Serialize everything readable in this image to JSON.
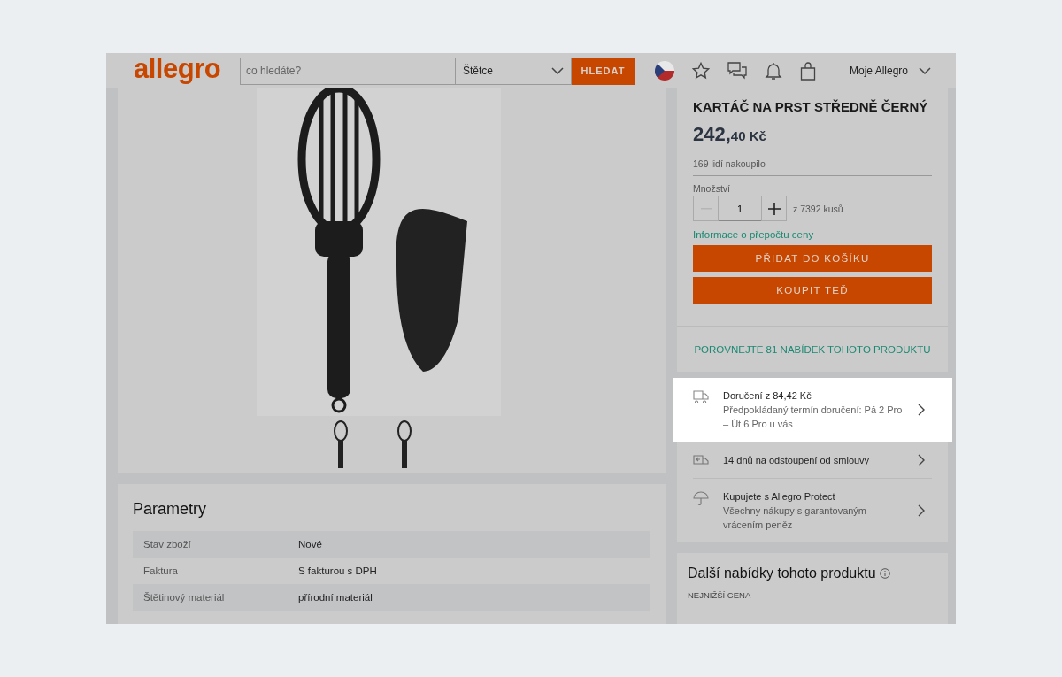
{
  "header": {
    "logo": "allegro",
    "search_placeholder": "co hledáte?",
    "category": "Štětce",
    "search_button": "HLEDAT",
    "account": "Moje Allegro"
  },
  "parameters": {
    "title": "Parametry",
    "rows": [
      {
        "name": "Stav zboží",
        "value": "Nové"
      },
      {
        "name": "Faktura",
        "value": "S fakturou s DPH"
      },
      {
        "name": "Štětinový materiál",
        "value": "přírodní materiál"
      }
    ]
  },
  "product": {
    "title": "KARTÁČ NA PRST STŘEDNĚ ČERNÝ",
    "price_integer": "242,",
    "price_rest": "40 Kč",
    "purchased": "169 lidí nakoupilo",
    "quantity_label": "Množství",
    "quantity": "1",
    "decrement_disabled": true,
    "stock": "z 7392 kusů",
    "price_info_link": "Informace o přepočtu ceny",
    "buttons": [
      "PŘIDAT DO KOŠÍKU",
      "KOUPIT TEĎ"
    ],
    "compare_link": "POROVNEJTE 81 NABÍDEK TOHOTO PRODUKTU"
  },
  "info_rows": [
    {
      "kind": "delivery",
      "highlighted": true,
      "title": "Doručení z 84,42 Kč",
      "detail": "Předpokládaný termín doručení: Pá 2 Pro – Út 6 Pro u vás"
    },
    {
      "kind": "returns",
      "highlighted": false,
      "title": "14 dnů na odstoupení od smlouvy"
    },
    {
      "kind": "protect",
      "highlighted": false,
      "title": "Kupujete s Allegro Protect",
      "detail": "Všechny nákupy s garantovaným vrácením peněz"
    }
  ],
  "other_offers": {
    "title": "Další nabídky tohoto produktu",
    "subtitle": "NEJNIŽŠÍ CENA"
  }
}
